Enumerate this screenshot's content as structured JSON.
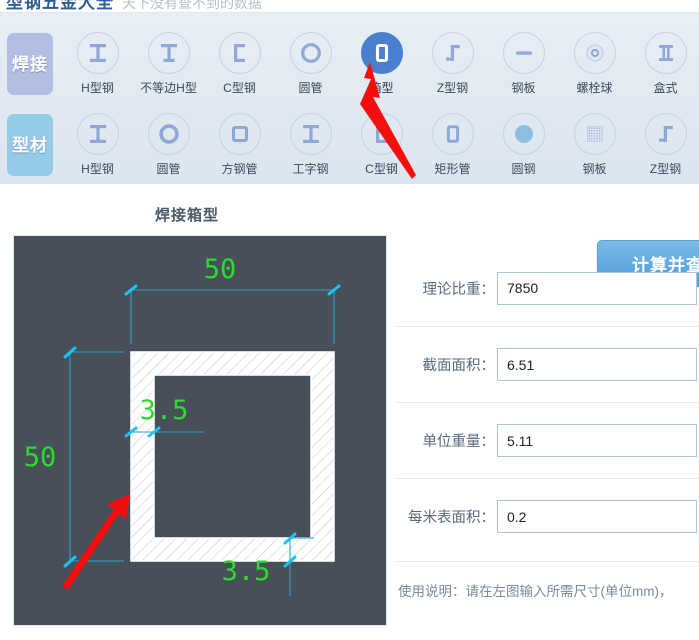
{
  "header": {
    "app_title": "型钢五金大全",
    "app_subtitle": "天下没有查不到的数据"
  },
  "ribbon": {
    "rows": [
      {
        "category_label": "焊接",
        "category_color": "#b3bee3",
        "items": [
          {
            "label": "H型钢",
            "icon": "h-beam-icon",
            "selected": false
          },
          {
            "label": "不等边H型",
            "icon": "unequal-h-beam-icon",
            "selected": false
          },
          {
            "label": "C型钢",
            "icon": "c-channel-icon",
            "selected": false
          },
          {
            "label": "圆管",
            "icon": "round-pipe-icon",
            "selected": false
          },
          {
            "label": "箱型",
            "icon": "box-section-icon",
            "selected": true
          },
          {
            "label": "Z型钢",
            "icon": "z-beam-icon",
            "selected": false
          },
          {
            "label": "钢板",
            "icon": "steel-plate-icon",
            "selected": false
          },
          {
            "label": "螺栓球",
            "icon": "bolt-ball-icon",
            "selected": false
          },
          {
            "label": "盒式",
            "icon": "box-type-icon",
            "selected": false
          }
        ]
      },
      {
        "category_label": "型材",
        "category_color": "#95cbe8",
        "items": [
          {
            "label": "H型钢",
            "icon": "h-beam-icon",
            "selected": false
          },
          {
            "label": "圆管",
            "icon": "round-pipe-icon",
            "selected": false
          },
          {
            "label": "方钢管",
            "icon": "square-tube-icon",
            "selected": false
          },
          {
            "label": "工字钢",
            "icon": "i-beam-icon",
            "selected": false
          },
          {
            "label": "C型钢",
            "icon": "c-channel-icon",
            "selected": false
          },
          {
            "label": "矩形管",
            "icon": "rect-tube-icon",
            "selected": false
          },
          {
            "label": "圆钢",
            "icon": "round-bar-icon",
            "selected": false
          },
          {
            "label": "钢板",
            "icon": "steel-plate-mesh-icon",
            "selected": false
          },
          {
            "label": "Z型钢",
            "icon": "z-beam-icon",
            "selected": false
          }
        ]
      }
    ]
  },
  "main": {
    "section_title": "焊接箱型",
    "calc_button_label": "计算并查看",
    "fields": [
      {
        "label": "理论比重：",
        "value": "7850"
      },
      {
        "label": "截面面积：",
        "value": "6.51"
      },
      {
        "label": "单位重量：",
        "value": "5.11"
      },
      {
        "label": "每米表面积：",
        "value": "0.2"
      }
    ],
    "usage_note": "使用说明：请在左图输入所需尺寸(单位mm)，"
  },
  "drawing": {
    "background": "#474f59",
    "dimension_color": "#2f9fd0",
    "text_color": "#2bdd2b",
    "dims": {
      "width_top": "50",
      "height_left": "50",
      "thickness_top_inner": "3.5",
      "thickness_bottom": "3.5"
    },
    "annotations": [
      {
        "name": "red-arrow-to-box-section-icon",
        "color": "#f40f0f"
      },
      {
        "name": "red-arrow-to-wall-thickness",
        "color": "#f40f0f"
      }
    ]
  }
}
